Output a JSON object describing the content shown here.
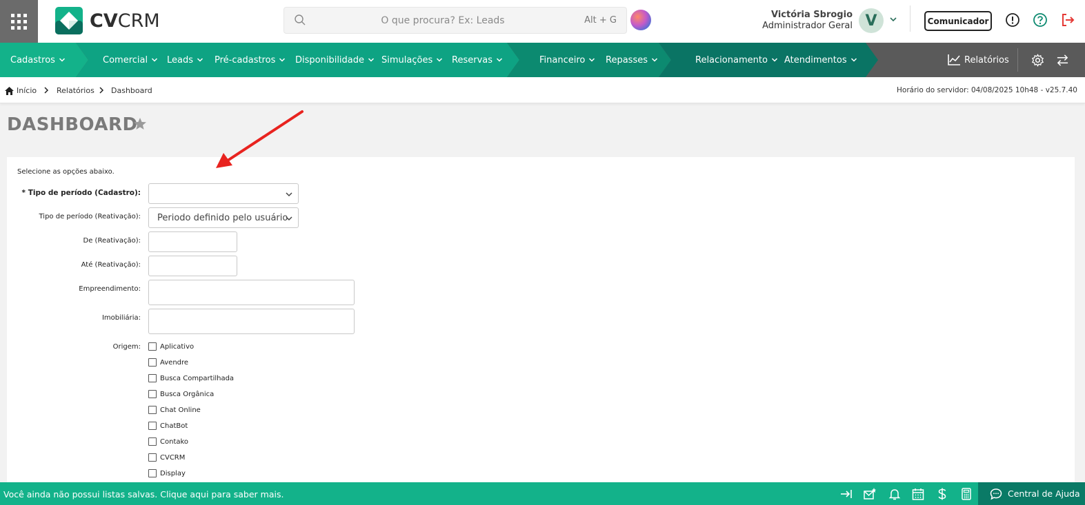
{
  "brand": {
    "logo_text_bold": "CV",
    "logo_text_rest": "CRM"
  },
  "search": {
    "placeholder": "O que procura? Ex: Leads",
    "shortcut": "Alt + G"
  },
  "user": {
    "name": "Victória Sbrogio",
    "role": "Administrador Geral",
    "avatar_initial": "V"
  },
  "header": {
    "comunicador_label": "Comunicador"
  },
  "nav": {
    "items": [
      {
        "label": "Cadastros"
      },
      {
        "label": "Comercial"
      },
      {
        "label": "Leads"
      },
      {
        "label": "Pré-cadastros"
      },
      {
        "label": "Disponibilidade"
      },
      {
        "label": "Simulações"
      },
      {
        "label": "Reservas"
      },
      {
        "label": "Financeiro"
      },
      {
        "label": "Repasses"
      },
      {
        "label": "Relacionamento"
      },
      {
        "label": "Atendimentos"
      }
    ],
    "reports_label": "Relatórios",
    "colors": {
      "seg1": "#13b28a",
      "seg2": "#0ea383",
      "seg3": "#0c8a70",
      "seg4": "#0a7464",
      "rest": "#5a5a5a"
    }
  },
  "breadcrumb": {
    "items": [
      "Início",
      "Relatórios",
      "Dashboard"
    ],
    "server_time": "Horário do servidor: 04/08/2025 10h48 - v25.7.40"
  },
  "page": {
    "title": "DASHBOARD"
  },
  "form": {
    "hint": "Selecione as opções abaixo.",
    "tipo_cadastro_label": "* Tipo de período (Cadastro):",
    "tipo_cadastro_value": "",
    "tipo_reativacao_label": "Tipo de período (Reativação):",
    "tipo_reativacao_value": "Periodo definido pelo usuário",
    "de_label": "De (Reativação):",
    "ate_label": "Até (Reativação):",
    "empreendimento_label": "Empreendimento:",
    "imobiliaria_label": "Imobiliária:",
    "origem_label": "Origem:",
    "origem_options": [
      "Aplicativo",
      "Avendre",
      "Busca Compartilhada",
      "Busca Orgânica",
      "Chat Online",
      "ChatBot",
      "Contako",
      "CVCRM",
      "Display"
    ]
  },
  "footer": {
    "message": "Você ainda não possui listas salvas. Clique aqui para saber mais.",
    "help_label": "Central de Ajuda"
  }
}
